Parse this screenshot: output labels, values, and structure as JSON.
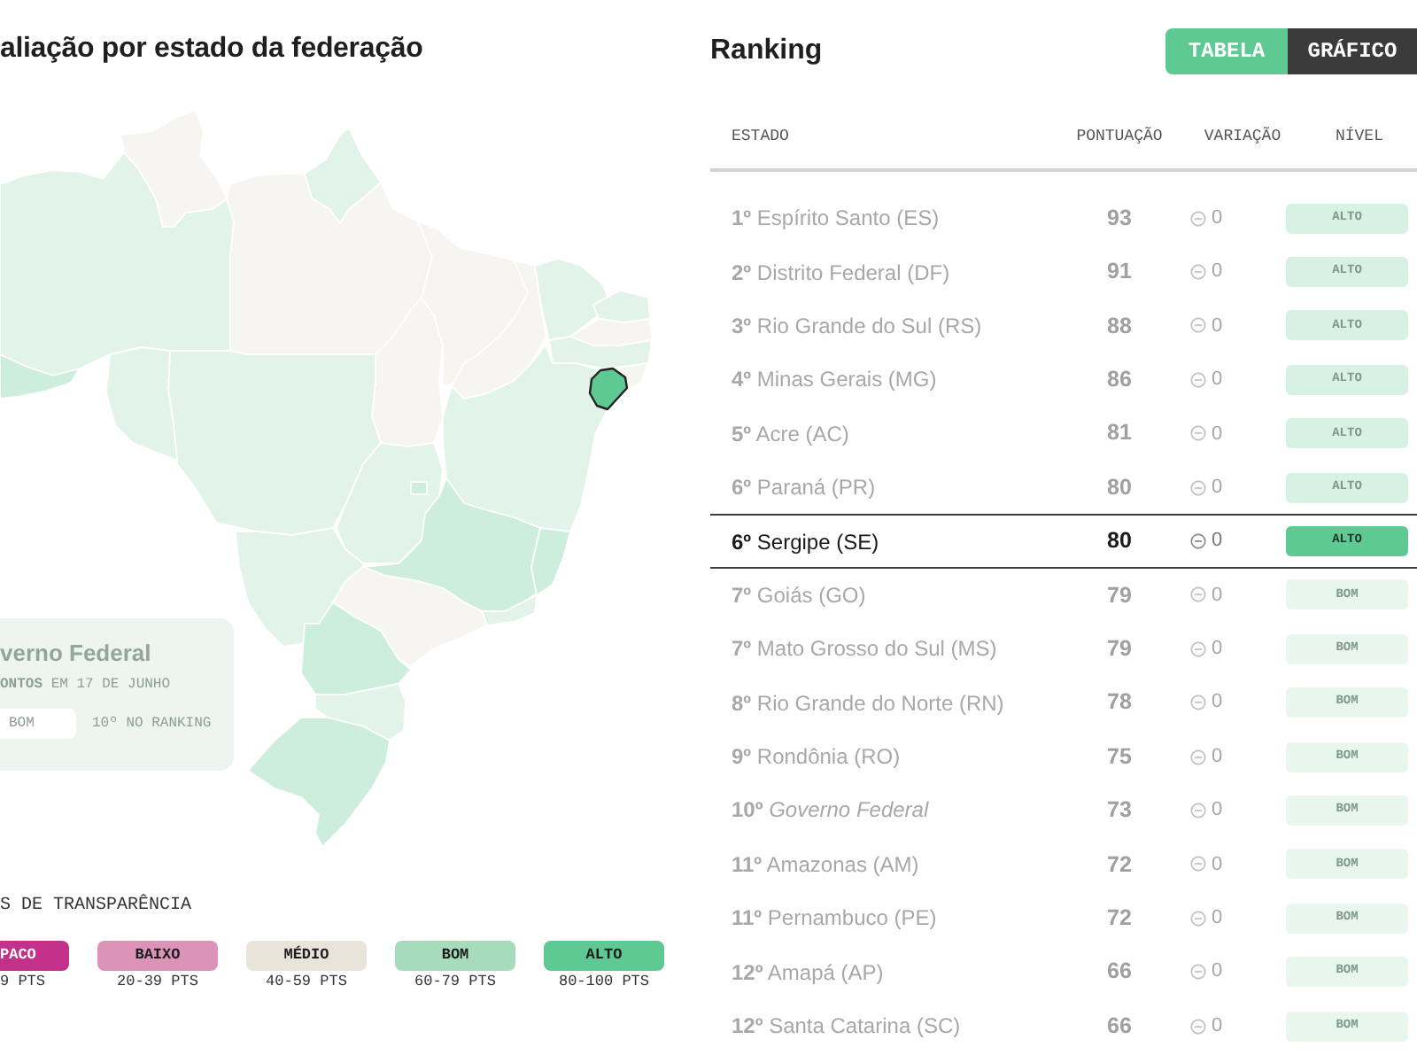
{
  "left_panel": {
    "title": "aliação por estado da federação",
    "map": {
      "regions": [
        {
          "color": "#e2f3e9",
          "selected": false
        },
        {
          "color": "#cdeedc",
          "selected": false
        },
        {
          "color": "#f6f5f1",
          "selected": false
        },
        {
          "color": "#e2f3e9",
          "selected": false
        },
        {
          "color": "#f6f5f1",
          "selected": false
        },
        {
          "color": "#f6f5f1",
          "selected": false
        },
        {
          "color": "#f6f5f1",
          "selected": false
        },
        {
          "color": "#f6f5f1",
          "selected": false
        },
        {
          "color": "#e2f3e9",
          "selected": false
        },
        {
          "color": "#e2f3e9",
          "selected": false
        },
        {
          "color": "#f6f5f1",
          "selected": false
        },
        {
          "color": "#e2f3e9",
          "selected": false
        },
        {
          "color": "#f6f5f1",
          "selected": false
        },
        {
          "color": "#e2f3e9",
          "selected": false
        },
        {
          "color": "#5ec993",
          "selected": true
        },
        {
          "color": "#e2f3e9",
          "selected": false
        },
        {
          "color": "#e2f3e9",
          "selected": false
        },
        {
          "color": "#e2f3e9",
          "selected": false
        },
        {
          "color": "#cdeedc",
          "selected": false
        },
        {
          "color": "#cdeedc",
          "selected": false
        },
        {
          "color": "#e2f3e9",
          "selected": false
        },
        {
          "color": "#f6f5f1",
          "selected": false
        },
        {
          "color": "#e2f3e9",
          "selected": false
        },
        {
          "color": "#cdeedc",
          "selected": false
        },
        {
          "color": "#e2f3e9",
          "selected": false
        },
        {
          "color": "#cdeedc",
          "selected": false
        },
        {
          "color": "#cdeedc",
          "selected": false
        }
      ]
    },
    "info_card": {
      "title": "verno Federal",
      "subtitle": "**ONTOS** EM 17 DE JUNHO",
      "badge": "BOM",
      "ranking": "10º NO RANKING"
    },
    "legend": {
      "title": "S DE TRANSPARÊNCIA",
      "items": [
        {
          "kind": "opaco",
          "label": "PACO",
          "range": "9 PTS",
          "color": "#c4318b"
        },
        {
          "kind": "baixo",
          "label": "BAIXO",
          "range": "20-39 PTS",
          "color": "#dc93b8"
        },
        {
          "kind": "medio",
          "label": "MÉDIO",
          "range": "40-59 PTS",
          "color": "#e8e4da"
        },
        {
          "kind": "bom",
          "label": "BOM",
          "range": "60-79 PTS",
          "color": "#a6dcbb"
        },
        {
          "kind": "alto",
          "label": "ALTO",
          "range": "80-100 PTS",
          "color": "#5ec993"
        }
      ]
    }
  },
  "ranking": {
    "title": "Ranking",
    "view_toggle": [
      {
        "label": "TABELA",
        "selected": true
      },
      {
        "label": "GRÁFICO",
        "selected": false
      }
    ],
    "columns": [
      "ESTADO",
      "PONTUAÇÃO",
      "VARIAÇÃO",
      "NÍVEL"
    ],
    "rows": [
      {
        "state": "**1º** Espírito Santo (ES)",
        "score": "93",
        "variation": "0",
        "level_label": "ALTO",
        "kind": "alto",
        "selected": false
      },
      {
        "state": "**2º** Distrito Federal (DF)",
        "score": "91",
        "variation": "0",
        "level_label": "ALTO",
        "kind": "alto",
        "selected": false
      },
      {
        "state": "**3º** Rio Grande do Sul (RS)",
        "score": "88",
        "variation": "0",
        "level_label": "ALTO",
        "kind": "alto",
        "selected": false
      },
      {
        "state": "**4º** Minas Gerais (MG)",
        "score": "86",
        "variation": "0",
        "level_label": "ALTO",
        "kind": "alto",
        "selected": false
      },
      {
        "state": "**5º** Acre (AC)",
        "score": "81",
        "variation": "0",
        "level_label": "ALTO",
        "kind": "alto",
        "selected": false
      },
      {
        "state": "**6º** Paraná (PR)",
        "score": "80",
        "variation": "0",
        "level_label": "ALTO",
        "kind": "alto",
        "selected": false
      },
      {
        "state": "**6º** Sergipe (SE)",
        "score": "80",
        "variation": "0",
        "level_label": "ALTO",
        "kind": "alto",
        "selected": true
      },
      {
        "state": "**7º** Goiás (GO)",
        "score": "79",
        "variation": "0",
        "level_label": "BOM",
        "kind": "bom",
        "selected": false
      },
      {
        "state": "**7º** Mato Grosso do Sul (MS)",
        "score": "79",
        "variation": "0",
        "level_label": "BOM",
        "kind": "bom",
        "selected": false
      },
      {
        "state": "**8º** Rio Grande do Norte (RN)",
        "score": "78",
        "variation": "0",
        "level_label": "BOM",
        "kind": "bom",
        "selected": false
      },
      {
        "state": "**9º** Rondônia (RO)",
        "score": "75",
        "variation": "0",
        "level_label": "BOM",
        "kind": "bom",
        "selected": false
      },
      {
        "state": "**10º** *Governo Federal*",
        "score": "73",
        "variation": "0",
        "level_label": "BOM",
        "kind": "bom",
        "selected": false
      },
      {
        "state": "**11º** Amazonas (AM)",
        "score": "72",
        "variation": "0",
        "level_label": "BOM",
        "kind": "bom",
        "selected": false
      },
      {
        "state": "**11º** Pernambuco (PE)",
        "score": "72",
        "variation": "0",
        "level_label": "BOM",
        "kind": "bom",
        "selected": false
      },
      {
        "state": "**12º** Amapá (AP)",
        "score": "66",
        "variation": "0",
        "level_label": "BOM",
        "kind": "bom",
        "selected": false
      },
      {
        "state": "**12º** Santa Catarina (SC)",
        "score": "66",
        "variation": "0",
        "level_label": "BOM",
        "kind": "bom",
        "selected": false
      }
    ]
  }
}
